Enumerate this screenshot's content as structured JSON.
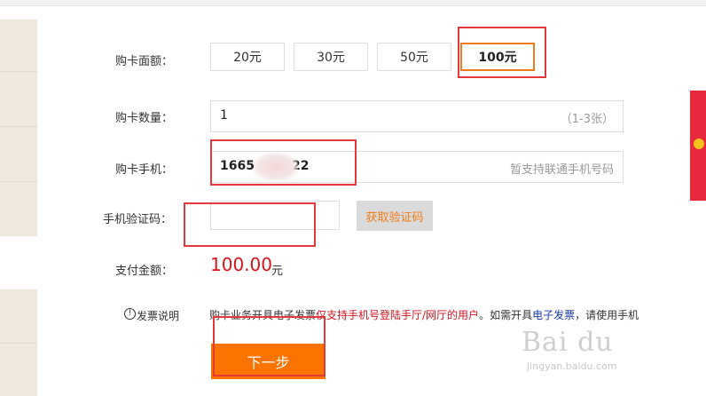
{
  "form": {
    "amount_label": "购卡面额：",
    "amounts": [
      "20元",
      "30元",
      "50元",
      "100元"
    ],
    "selected_amount": "100元",
    "quantity_label": "购卡数量：",
    "quantity_value": "1",
    "quantity_hint": "（1-3张）",
    "phone_label": "购卡手机：",
    "phone_prefix": "1665",
    "phone_suffix": "22",
    "phone_hint": "暂支持联通手机号码",
    "code_label": "手机验证码：",
    "code_value": "",
    "get_code_button": "获取验证码",
    "pay_label": "支付金额：",
    "pay_amount": "100.00",
    "pay_unit": "元",
    "invoice_label": "发票说明",
    "invoice_text_prefix": "购卡业务开具电子发票",
    "invoice_text_red": "仅支持手机号登陆手厅/网厅的用户",
    "invoice_text_mid": "。如需开具",
    "invoice_text_link": "电子发票",
    "invoice_text_suffix": "，请使用手机",
    "next_button": "下一步"
  },
  "colors": {
    "accent": "#fb7300",
    "price": "#d5141e",
    "highlight_box": "#e23a3a"
  },
  "watermark": {
    "brand": "Bai du",
    "url": "jingyan.baidu.com"
  }
}
